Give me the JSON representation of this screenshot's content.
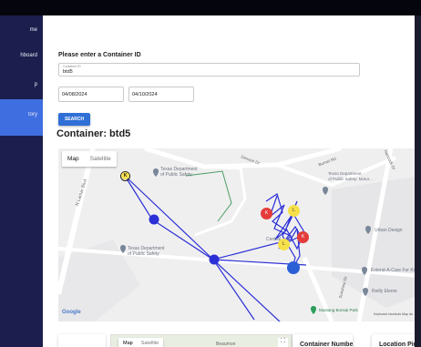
{
  "sidebar": {
    "items": [
      {
        "label": "me"
      },
      {
        "label": "hboard"
      },
      {
        "label": "p"
      },
      {
        "label": "tory"
      }
    ]
  },
  "form": {
    "prompt": "Please enter a Container ID",
    "container_field": {
      "label": "Container ID",
      "value": "btd5"
    },
    "start_date": "04/08/2024",
    "end_date": "04/10/2024",
    "search_label": "SEARCH"
  },
  "container_title": "Container: btd5",
  "map": {
    "map_label": "Map",
    "satellite_label": "Satellite",
    "labels": {
      "texas_dept_top": "Texas Department\nof Public Safety",
      "texas_dept_right": "Texas Department\nof Public Safety: Motor...",
      "texas_dept_left": "Texas Department\nof Public Safety",
      "lamar": "N Lamar Blvd",
      "denson": "Denson Dr",
      "hancock": "Hancock Dr",
      "burnet": "Burnet Rd",
      "sunshine": "Sunshine Dr",
      "urban": "Urban Design",
      "extend": "Extend-A-Care For Kids",
      "reilly": "Reilly Eleme",
      "mustang": "Mustang Bonsai Park",
      "central": "Central"
    },
    "markers": [
      {
        "text": "K",
        "color": "#f6e04a"
      },
      {
        "text": "K",
        "color": "#e53b3b"
      },
      {
        "text": "L",
        "color": "#f6e04a"
      },
      {
        "text": "L",
        "color": "#f6e04a"
      },
      {
        "text": "K",
        "color": "#e53b3b"
      }
    ],
    "google": "Google",
    "footer": "Keyboard shortcuts   Map da"
  },
  "map_small": {
    "map_label": "Map",
    "satellite_label": "Satellite",
    "place": "Beaumon"
  },
  "table_headers": {
    "container_number": "Container Number",
    "location_pin": "Location Pin"
  },
  "colors": {
    "accent": "#2f6fd6",
    "sidebar_bg": "#1c1f4d",
    "sidebar_active": "#3f6ee0",
    "route": "#2b2fd6"
  }
}
